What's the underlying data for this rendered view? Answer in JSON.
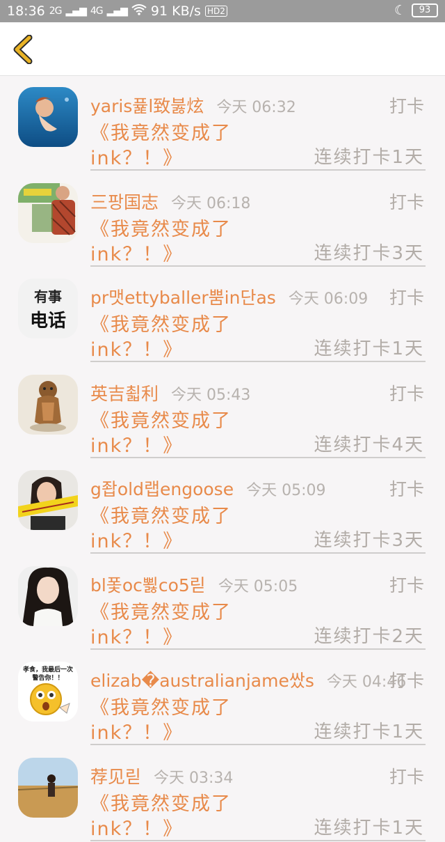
{
  "status_bar": {
    "time": "18:36",
    "signal1": "2G",
    "signal2": "4G",
    "speed": "91 KB/s",
    "hd": "HD2",
    "battery": "93"
  },
  "header": {
    "back_icon": "chevron-left-icon"
  },
  "colors": {
    "accent": "#e88a4a",
    "muted": "#b2aca7",
    "back": "#e9b325"
  },
  "items": [
    {
      "name": "yaris퓵l致붏炫",
      "time": "今天 06:32",
      "action": "打卡",
      "title_line1": "《我竟然变成了",
      "title_line2": "ink？！》",
      "streak": "连续打卡1天"
    },
    {
      "name": "三팡国志",
      "time": "今天 06:18",
      "action": "打卡",
      "title_line1": "《我竟然变成了",
      "title_line2": "ink？！》",
      "streak": "连续打卡3天"
    },
    {
      "name": "pr맷ettyballer뿜in단as",
      "time": "今天 06:09",
      "action": "打卡",
      "title_line1": "《我竟然变成了",
      "title_line2": "ink？！》",
      "streak": "连续打卡1天"
    },
    {
      "name": "英吉쵧利",
      "time": "今天 05:43",
      "action": "打卡",
      "title_line1": "《我竟然变成了",
      "title_line2": "ink？！》",
      "streak": "连续打卡4天"
    },
    {
      "name": "g좝old랩engoose",
      "time": "今天 05:09",
      "action": "打卡",
      "title_line1": "《我竟然变成了",
      "title_line2": "ink？！》",
      "streak": "连续打卡3天"
    },
    {
      "name": "bl퐃oc뾣co5릳",
      "time": "今天 05:05",
      "action": "打卡",
      "title_line1": "《我竟然变成了",
      "title_line2": "ink？！》",
      "streak": "连续打卡2天"
    },
    {
      "name": "elizab�australianjame쌌s",
      "time": "今天 04:46",
      "action": "打卡",
      "title_line1": "《我竟然变成了",
      "title_line2": "ink？！》",
      "streak": "连续打卡1天"
    },
    {
      "name": "荐见릳",
      "time": "今天 03:34",
      "action": "打卡",
      "title_line1": "《我竟然变成了",
      "title_line2": "ink？！》",
      "streak": "连续打卡1天"
    }
  ],
  "avatars": [
    {
      "type": "photo-underwater",
      "label": ""
    },
    {
      "type": "photo-man",
      "label": ""
    },
    {
      "type": "text",
      "line1": "有事",
      "line2": "电话"
    },
    {
      "type": "photo-dog",
      "label": ""
    },
    {
      "type": "photo-woman-banner",
      "label": ""
    },
    {
      "type": "photo-woman-longhair",
      "label": ""
    },
    {
      "type": "emoji",
      "caption1": "孝食，我最后一次",
      "caption2": "警告你！！"
    },
    {
      "type": "photo-field",
      "label": ""
    }
  ]
}
